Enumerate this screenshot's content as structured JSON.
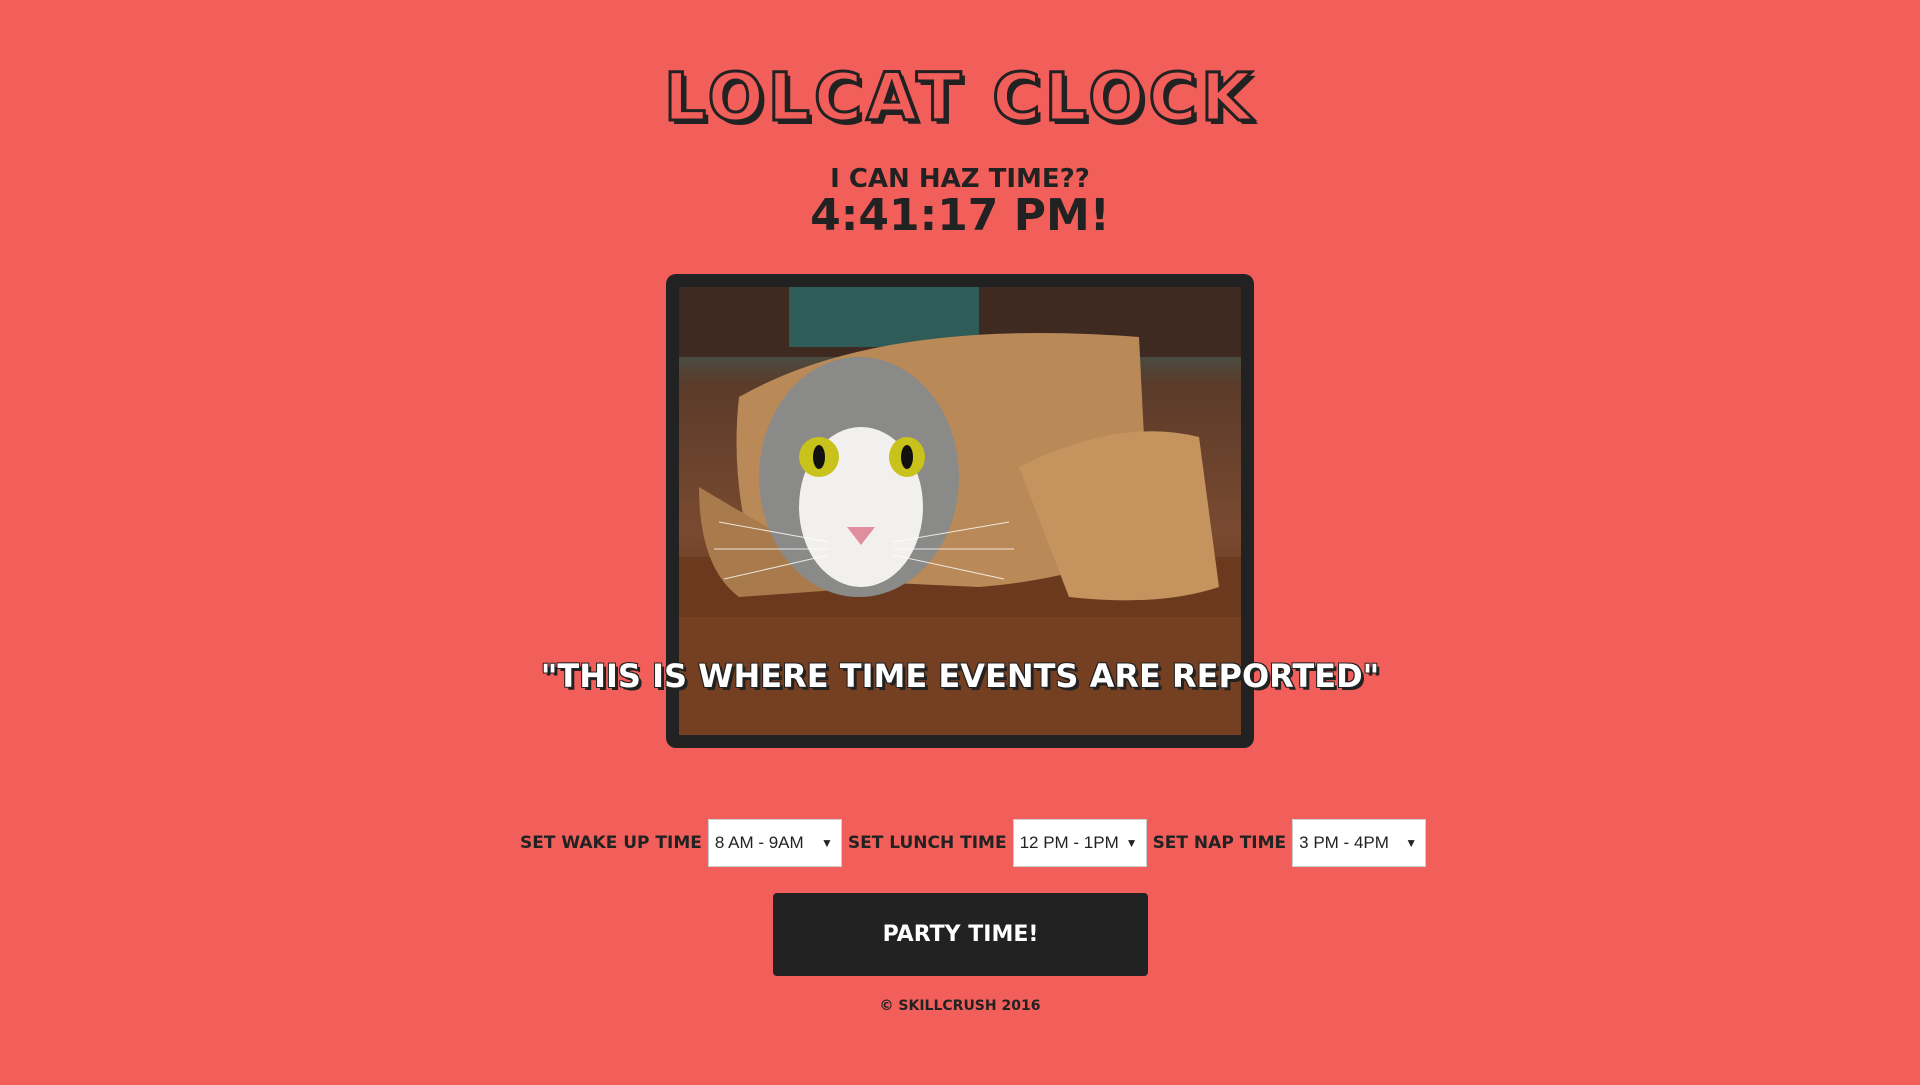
{
  "header": {
    "title": "LOLCAT CLOCK",
    "subtitle": "I CAN HAZ TIME??",
    "time": "4:41:17 PM!"
  },
  "event": {
    "text": "\"THIS IS WHERE TIME EVENTS ARE REPORTED\""
  },
  "controls": {
    "wake_label": "SET WAKE UP TIME",
    "wake_value": "8 AM - 9AM",
    "lunch_label": "SET LUNCH TIME",
    "lunch_value": "12 PM - 1PM",
    "nap_label": "SET NAP TIME",
    "nap_value": "3 PM - 4PM"
  },
  "party_button": "PARTY TIME!",
  "footer": "© SKILLCRUSH 2016",
  "colors": {
    "background": "#f25f5a",
    "dark": "#222222",
    "white": "#ffffff"
  }
}
